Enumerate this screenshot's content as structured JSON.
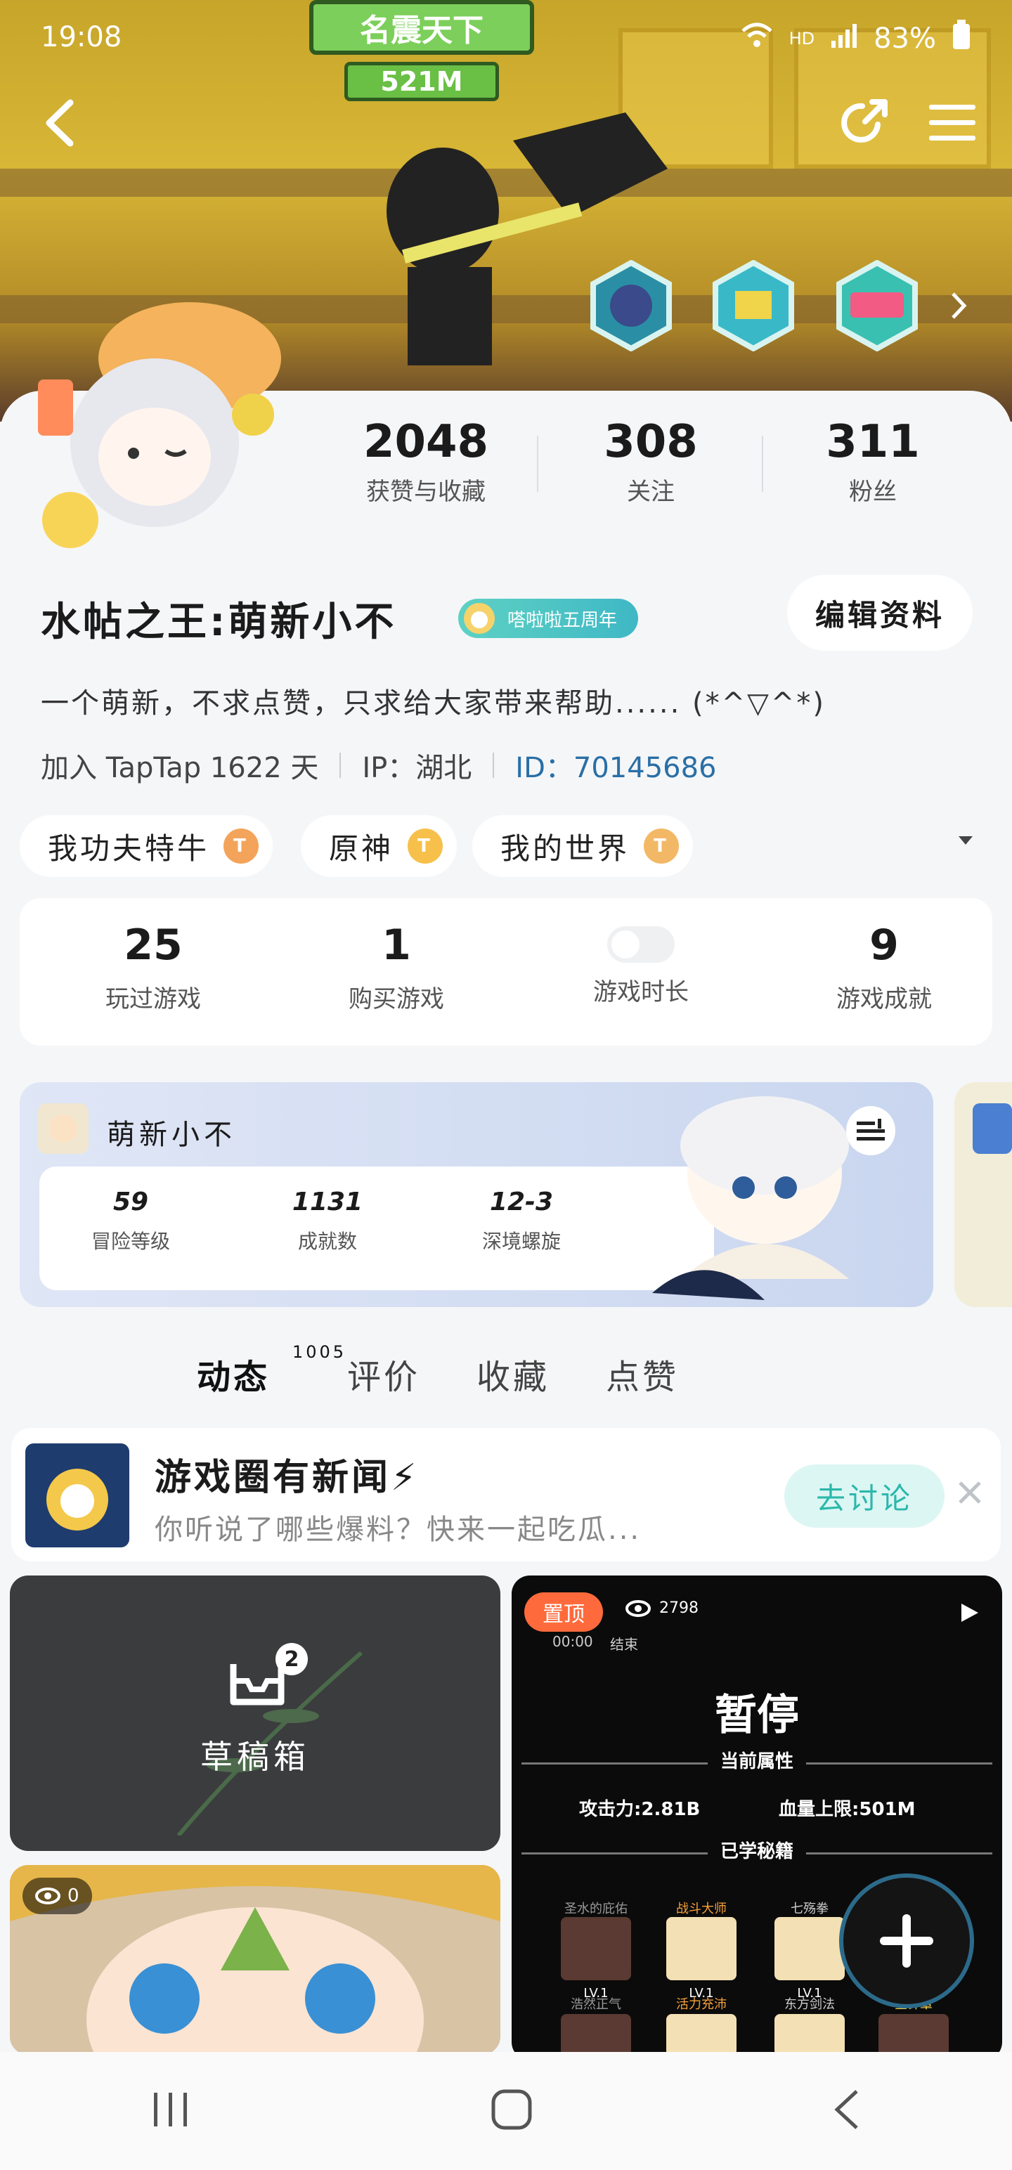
{
  "status_bar": {
    "time": "19:08",
    "network": "HD",
    "battery": "83%"
  },
  "banner": {
    "title": "名震天下",
    "score": "521M"
  },
  "header": {
    "back_icon": "back-arrow-icon",
    "share_icon": "share-icon",
    "menu_icon": "hamburger-menu-icon"
  },
  "badges": [
    "badge-1",
    "badge-2",
    "TapTap 游戏节"
  ],
  "stats": [
    {
      "value": "2048",
      "label": "获赞与收藏"
    },
    {
      "value": "308",
      "label": "关注"
    },
    {
      "value": "311",
      "label": "粉丝"
    }
  ],
  "profile": {
    "name": "水帖之王:萌新小不",
    "tag": "嗒啦啦五周年",
    "edit_label": "编辑资料",
    "bio": "一个萌新，不求点赞，只求给大家带来帮助...... (*^▽^*)",
    "joined": "加入 TapTap 1622 天",
    "ip": "IP：湖北",
    "id": "ID：70145686"
  },
  "game_chips": [
    {
      "label": "我功夫特牛",
      "level": "T"
    },
    {
      "label": "原神",
      "level": "T"
    },
    {
      "label": "我的世界",
      "level": "T"
    }
  ],
  "summary": [
    {
      "value": "25",
      "label": "玩过游戏"
    },
    {
      "value": "1",
      "label": "购买游戏"
    },
    {
      "value": "",
      "label": "游戏时长"
    },
    {
      "value": "9",
      "label": "游戏成就"
    }
  ],
  "game_card": {
    "player": "萌新小不",
    "stats": [
      {
        "value": "59",
        "label": "冒险等级"
      },
      {
        "value": "1131",
        "label": "成就数"
      },
      {
        "value": "12-3",
        "label": "深境螺旋"
      }
    ]
  },
  "tabs": [
    {
      "label": "动态",
      "count": "1005"
    },
    {
      "label": "评价"
    },
    {
      "label": "收藏"
    },
    {
      "label": "点赞"
    }
  ],
  "news": {
    "title": "游戏圈有新闻⚡",
    "subtitle": "你听说了哪些爆料？快来一起吃瓜...",
    "button": "去讨论",
    "close_icon": "close-icon"
  },
  "draft": {
    "label": "草稿箱",
    "count": "2"
  },
  "video": {
    "pinned": "置顶",
    "views": "2798",
    "time": "00:00",
    "end": "结束",
    "pause_title": "暂停",
    "attr_title": "当前属性",
    "attack": "攻击力:2.81B",
    "hp": "血量上限:501M",
    "skills_title": "已学秘籍",
    "skills": [
      "圣水的庇佑",
      "战斗大师",
      "七殇拳",
      "浩然正气",
      "活力充沛",
      "东方剑法",
      "金钟罩"
    ],
    "lv": "LV.1"
  },
  "image_tile": {
    "views": "0"
  }
}
